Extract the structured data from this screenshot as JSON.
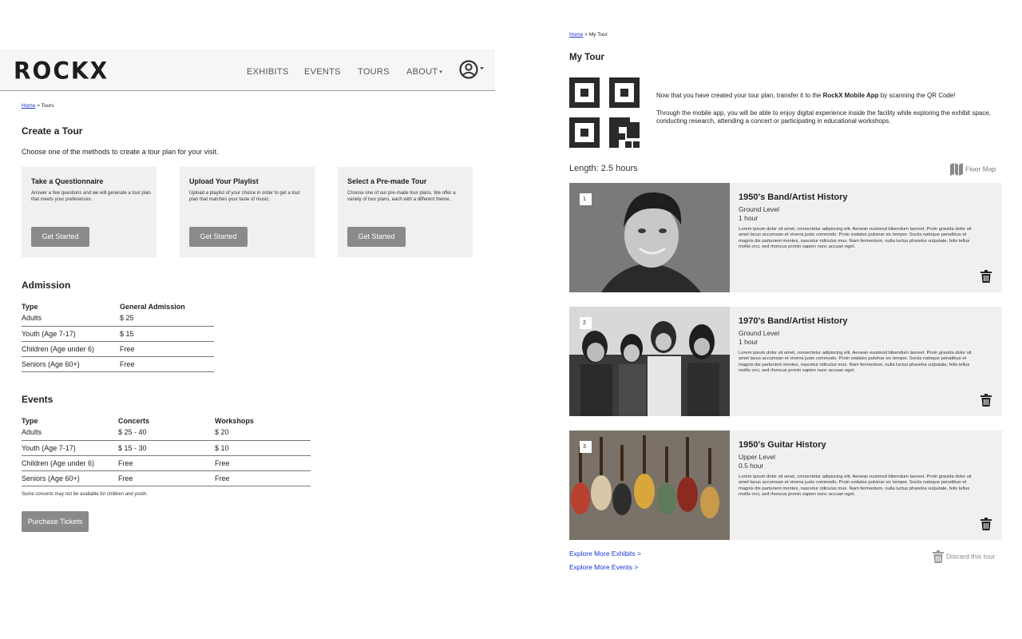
{
  "left": {
    "logo": "ROCKX",
    "nav": {
      "exhibits": "EXHIBITS",
      "events": "EVENTS",
      "tours": "TOURS",
      "about": "ABOUT",
      "about_caret": "▾",
      "user_caret": "▾"
    },
    "breadcrumb": {
      "home": "Home",
      "rest": " > Tours"
    },
    "create_title": "Create a Tour",
    "create_intro": "Choose one of the methods to create a tour plan for your visit.",
    "cards": [
      {
        "title": "Take a Questionnaire",
        "desc": "Answer a few questions and we will generate a tour plan that meets your preferences.",
        "button": "Get Started"
      },
      {
        "title": "Upload Your Playlist",
        "desc": "Upload a playlist of your choice in order to get a tour plan that matches your taste of music.",
        "button": "Get Started"
      },
      {
        "title": "Select a Pre-made Tour",
        "desc": "Choose one of our pre-made tour plans. We offer a variety of tour plans, each with a different theme.",
        "button": "Get Started"
      }
    ],
    "admission": {
      "title": "Admission",
      "headers": [
        "Type",
        "General Admission"
      ],
      "rows": [
        [
          "Adults",
          "$ 25"
        ],
        [
          "Youth (Age 7-17)",
          "$ 15"
        ],
        [
          "Children (Age under 6)",
          "Free"
        ],
        [
          "Seniors (Age 60+)",
          "Free"
        ]
      ]
    },
    "events": {
      "title": "Events",
      "headers": [
        "Type",
        "Concerts",
        "Workshops"
      ],
      "rows": [
        [
          "Adults",
          "$ 25 - 40",
          "$ 20"
        ],
        [
          "Youth (Age 7-17)",
          "$ 15 - 30",
          "$ 10"
        ],
        [
          "Children (Age under 6)",
          "Free",
          "Free"
        ],
        [
          "Seniors (Age 60+)",
          "Free",
          "Free"
        ]
      ],
      "note": "Some concerts may not be available for children and youth."
    },
    "purchase_button": "Purchase Tickets"
  },
  "right": {
    "breadcrumb": {
      "home": "Home",
      "rest": " > My Tour"
    },
    "title": "My Tour",
    "qr_text_prefix": "Now that you have created your tour plan, transfer it to the ",
    "qr_text_app": "RockX Mobile App",
    "qr_text_suffix": " by scanning the QR Code!",
    "qr_text2": "Through the mobile app, you will be able to enjoy digital experience inside the facility while exploring the exhibit space, conducting research, attending a concert or participating in educational workshops.",
    "length": "Length: 2.5 hours",
    "floor_map": "Floor Map",
    "stops": [
      {
        "num": "1",
        "title": "1950's Band/Artist History",
        "level": "Ground Level",
        "duration": "1 hour",
        "desc": "Lorem ipsum dolor sit amet, consectetur adipiscing elit. Aenean euismod bibendum laoreet. Proin gravida dolor sit amet lacus accumsan et viverra justo commodo. Proin sodales pulvinar sic tempor. Sociis natoque penatibus et magnis dis parturient montes, nascetur ridiculus mus. Nam fermentum, nulla luctus pharetra vulputate, felis tellus mollis orci, sed rhoncus pronin sapien nunc accuan eget."
      },
      {
        "num": "2",
        "title": "1970's Band/Artist History",
        "level": "Ground Level",
        "duration": "1 hour",
        "desc": "Lorem ipsum dolor sit amet, consectetur adipiscing elit. Aenean euismod bibendum laoreet. Proin gravida dolor sit amet lacus accumsan et viverra justo commodo. Proin sodales pulvinar sic tempor. Sociis natoque penatibus et magnis dis parturient montes, nascetur ridiculus mus. Nam fermentum, nulla luctus pharetra vulputate, felis tellus mollis orci, sed rhoncus pronin sapien nunc accuan eget."
      },
      {
        "num": "3",
        "title": "1950's Guitar History",
        "level": "Upper Level",
        "duration": "0.5 hour",
        "desc": "Lorem ipsum dolor sit amet, consectetur adipiscing elit. Aenean euismod bibendum laoreet. Proin gravida dolor sit amet lacus accumsan et viverra justo commodo. Proin sodales pulvinar sic tempor. Sociis natoque penatibus et magnis dis parturient montes, nascetur ridiculus mus. Nam fermentum, nulla luctus pharetra vulputate, felis tellus mollis orci, sed rhoncus pronin sapien nunc accuan eget."
      }
    ],
    "explore_exhibits": "Explore More Exhibits >",
    "explore_events": "Explore More Events >",
    "discard": "Discard this tour"
  },
  "icons": {
    "user": "user-circle-icon",
    "qr": "qr-code-icon",
    "map": "map-icon",
    "trash": "trash-icon"
  },
  "colors": {
    "link": "#1a35d6",
    "button": "#8a8a8a",
    "card_bg": "#f0f0f0",
    "header_bg": "#f6f6f6"
  }
}
